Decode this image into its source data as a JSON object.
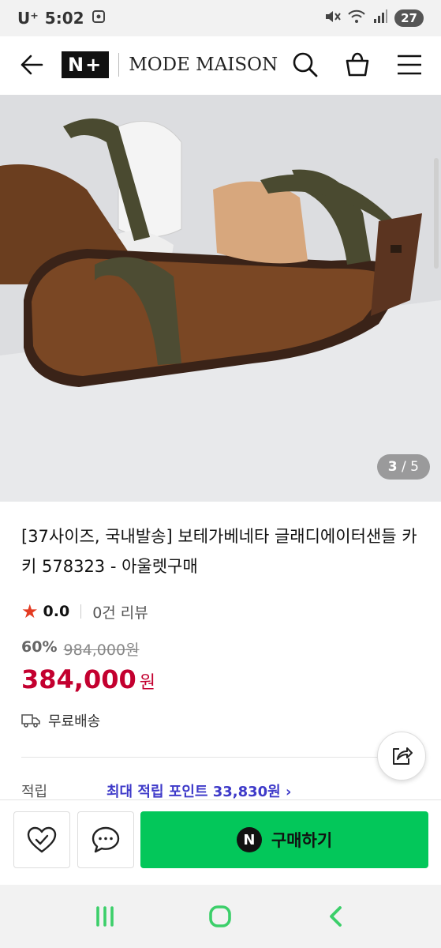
{
  "status_bar": {
    "carrier": "U⁺",
    "time": "5:02",
    "battery": "27"
  },
  "header": {
    "logo": "N+",
    "brand": "MODE MAISON",
    "icons": [
      "back-arrow-icon",
      "search-icon",
      "shopping-bag-icon",
      "menu-icon"
    ]
  },
  "gallery": {
    "current": "3",
    "separator": "/",
    "total": "5"
  },
  "product": {
    "title": "[37사이즈, 국내발송] 보테가베네타 글래디에이터샌들 카키 578323 - 아울렛구매",
    "rating": "0.0",
    "review_count": "0건 리뷰",
    "discount_rate": "60%",
    "original_price": "984,000원",
    "price": "384,000",
    "currency": "원",
    "shipping": "무료배송"
  },
  "points": {
    "label": "적립",
    "link": "최대 적립 포인트 33,830원 ›"
  },
  "bottom_bar": {
    "buy_label": "구매하기",
    "buy_badge": "N"
  },
  "colors": {
    "accent_green": "#03c75a",
    "price_red": "#c3002f",
    "points_blue": "#3e3ac9",
    "star_red": "#e33b22",
    "nav_green": "#3ccf6a"
  }
}
